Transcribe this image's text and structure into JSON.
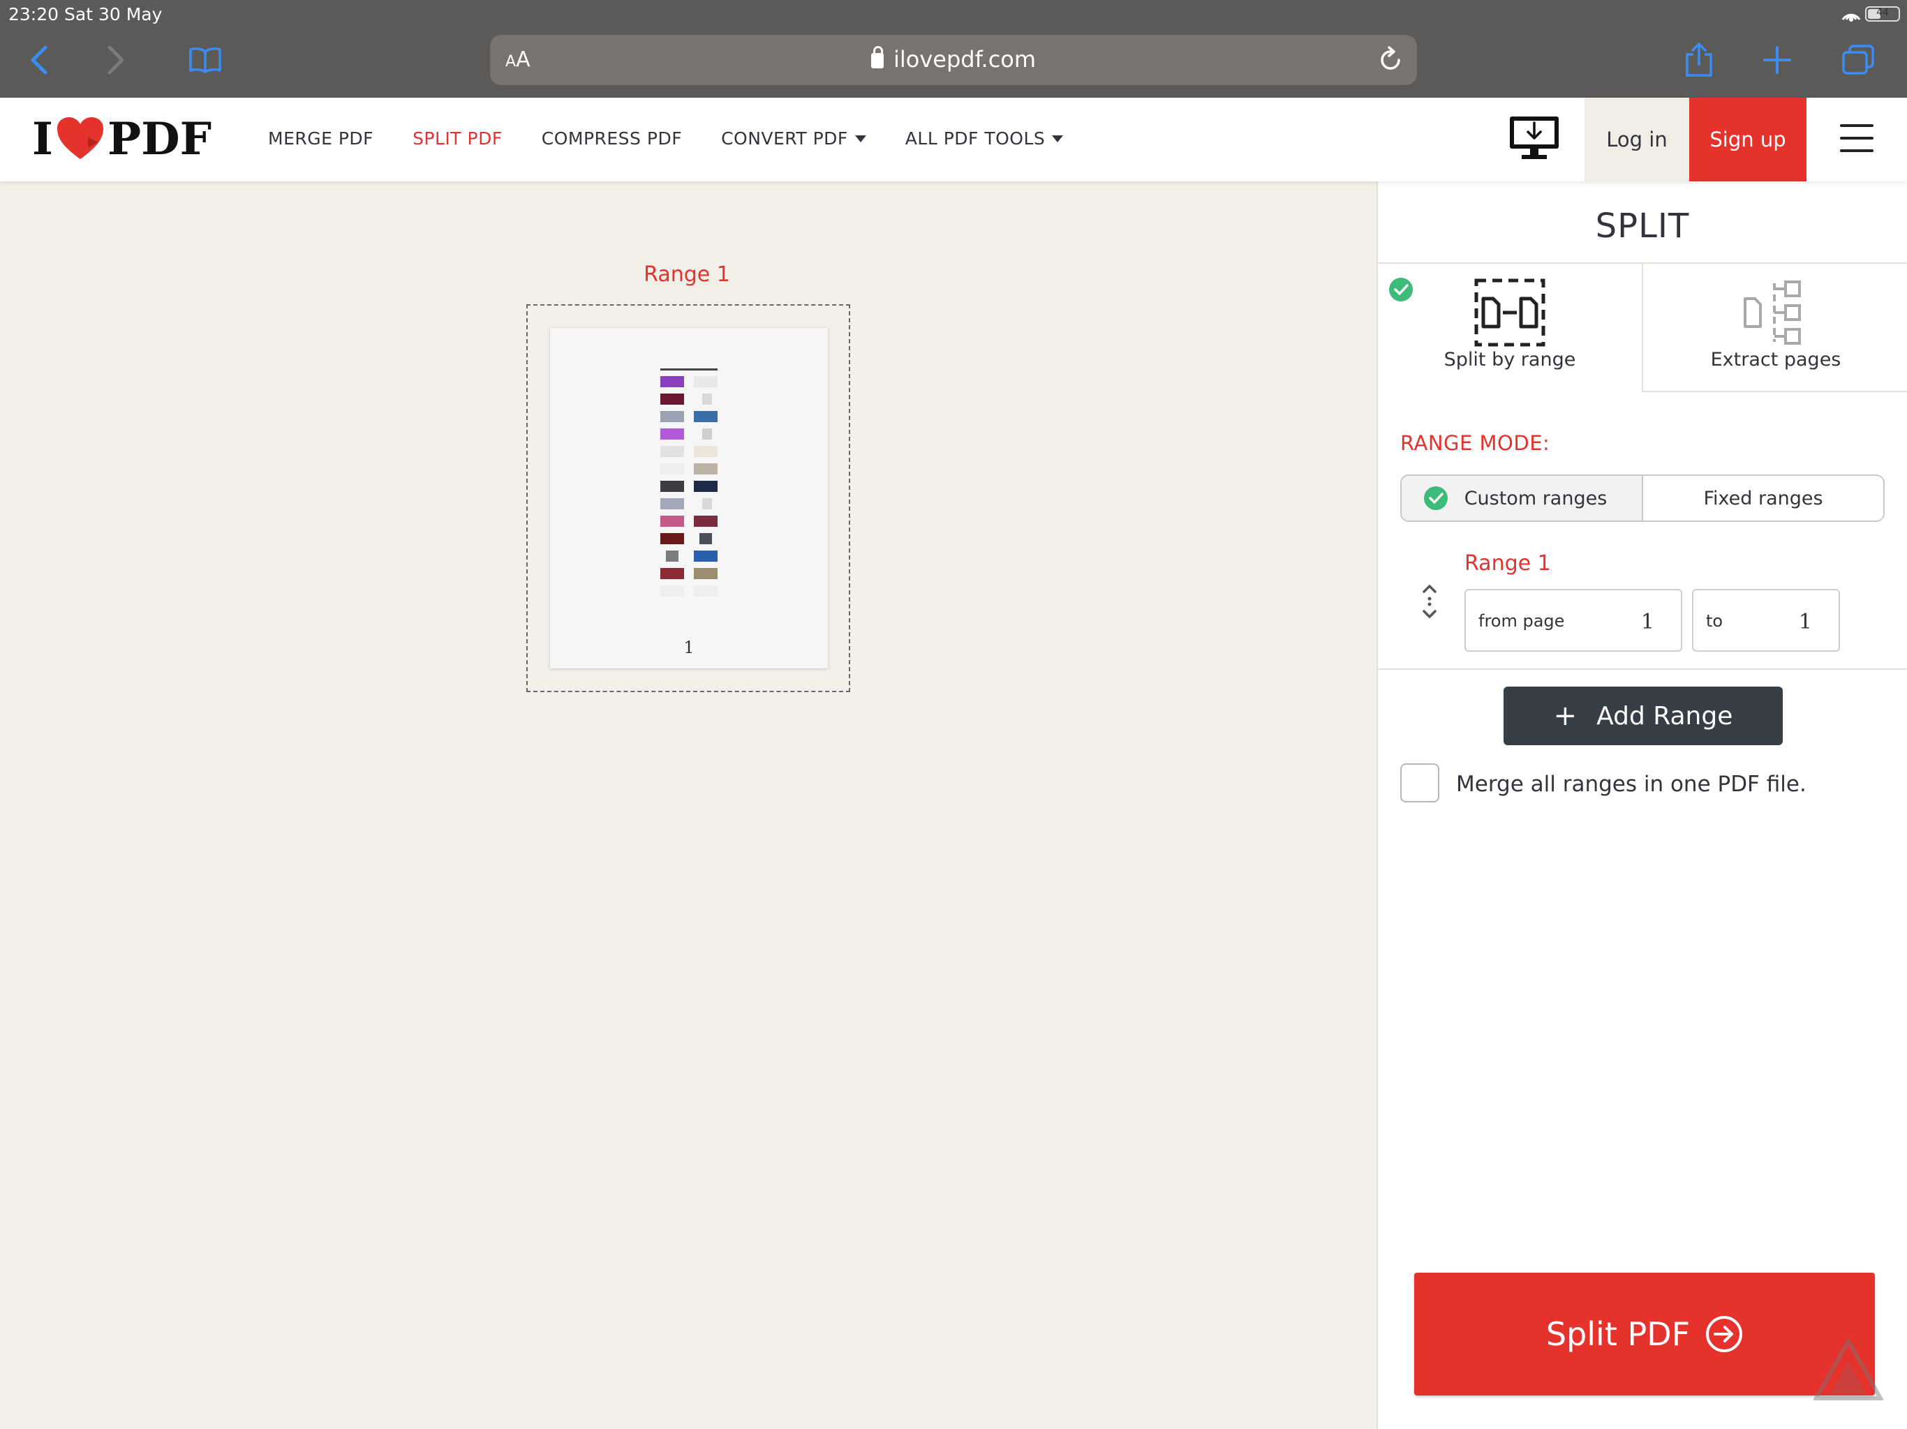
{
  "status_bar": {
    "time": "23:20",
    "date": "Sat 30 May",
    "battery": "44"
  },
  "browser": {
    "aa_label_small": "A",
    "aa_label_large": "A",
    "url": "ilovepdf.com"
  },
  "header": {
    "logo_left": "I",
    "logo_right": "PDF",
    "nav": [
      {
        "label": "MERGE PDF"
      },
      {
        "label": "SPLIT PDF"
      },
      {
        "label": "COMPRESS PDF"
      },
      {
        "label": "CONVERT PDF"
      },
      {
        "label": "ALL PDF TOOLS"
      }
    ],
    "login": "Log in",
    "signup": "Sign up"
  },
  "preview": {
    "range_caption": "Range 1",
    "page_number": "1"
  },
  "sidebar": {
    "title": "SPLIT",
    "tabs": [
      {
        "label": "Split by range",
        "selected": true
      },
      {
        "label": "Extract pages",
        "selected": false
      }
    ],
    "range_mode_label": "RANGE MODE:",
    "range_modes": [
      {
        "label": "Custom ranges",
        "selected": true
      },
      {
        "label": "Fixed ranges",
        "selected": false
      }
    ],
    "range": {
      "title": "Range 1",
      "from_label": "from page",
      "from_value": "1",
      "to_label": "to",
      "to_value": "1"
    },
    "add_range": "Add Range",
    "merge_label": "Merge all ranges in one PDF file.",
    "merge_checked": false,
    "split_button": "Split PDF"
  },
  "colors": {
    "brand_red": "#e5322d",
    "dark_button": "#383e45",
    "check_green": "#3dbb78",
    "workspace_bg": "#f2efe9"
  }
}
